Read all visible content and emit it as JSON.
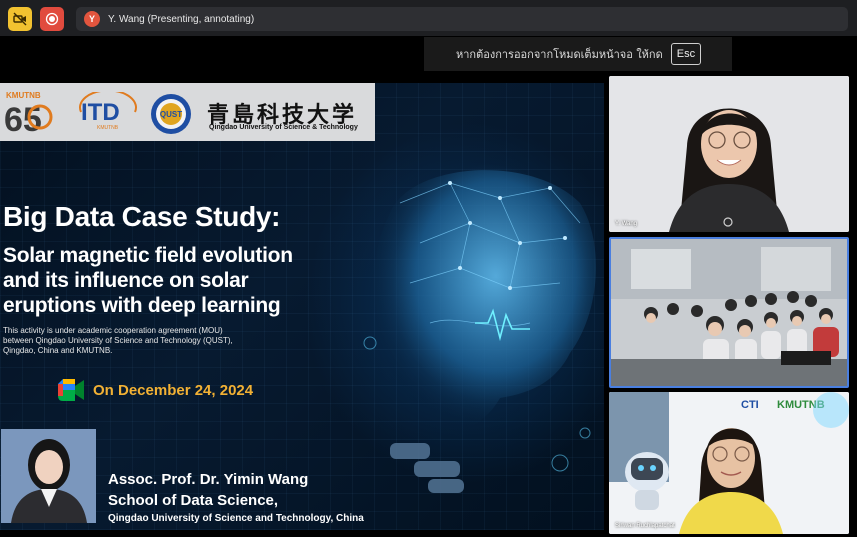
{
  "top_bar": {
    "presenter_initial": "Y",
    "presenter_label": "Y. Wang (Presenting, annotating)"
  },
  "fullscreen_notice": {
    "message": "หากต้องการออกจากโหมดเต็มหน้าจอ ให้กด",
    "key": "Esc"
  },
  "slide": {
    "logos": {
      "kmutnb": "KMUTNB",
      "kmutnb_number": "65",
      "itd": "ITD",
      "itd_sub": "KMUTNB",
      "qust": "QUST",
      "qust_chinese_name": "青島科技大学",
      "qust_english_name": "Qingdao University of Science & Technology"
    },
    "title": "Big Data Case Study:",
    "subtitle_lines": [
      "Solar magnetic field evolution",
      "and its influence on solar",
      "eruptions with deep learning"
    ],
    "mou_lines": [
      "This activity is under academic cooperation agreement (MOU)",
      "between Qingdao University of Science and Technology (QUST),",
      "Qingdao, China and KMUTNB."
    ],
    "date": "On December 24, 2024",
    "speaker": {
      "name": "Assoc. Prof. Dr. Yimin Wang",
      "school": "School of Data Science,",
      "university": "Qingdao University of Science and Technology, China"
    }
  },
  "participants": [
    {
      "name": "Y. Wang"
    },
    {
      "name": ""
    },
    {
      "name": "Siriwan Ruchlapatchat"
    }
  ],
  "tile3_logos": {
    "left": "CTI",
    "right": "KMUTNB"
  },
  "colors": {
    "topbar": "#1e1f22",
    "accent_yellow": "#f2c230",
    "accent_red": "#e14b3e",
    "date_orange": "#f2b134",
    "active_tile_border": "#4a7fe0"
  }
}
